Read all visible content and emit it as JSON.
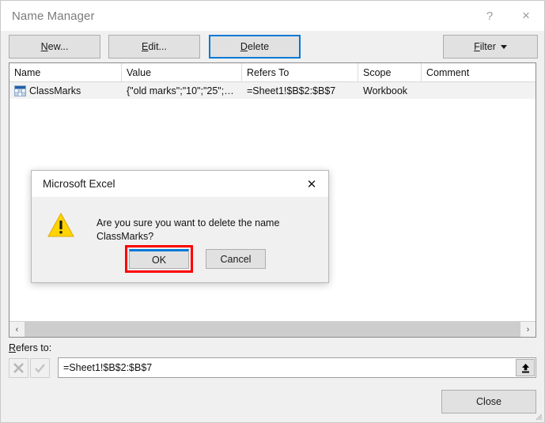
{
  "window": {
    "title": "Name Manager",
    "help_label": "?",
    "close_label": "×"
  },
  "toolbar": {
    "new_label": "New...",
    "new_accel": "N",
    "edit_label": "Edit...",
    "edit_accel": "E",
    "delete_label": "Delete",
    "delete_accel": "D",
    "filter_label": "Filter",
    "filter_accel": "F",
    "focused_button": "delete"
  },
  "list": {
    "columns": [
      {
        "key": "name",
        "label": "Name"
      },
      {
        "key": "value",
        "label": "Value"
      },
      {
        "key": "refers_to",
        "label": "Refers To"
      },
      {
        "key": "scope",
        "label": "Scope"
      },
      {
        "key": "comment",
        "label": "Comment"
      }
    ],
    "rows": [
      {
        "icon": "range-grid-icon",
        "name": "ClassMarks",
        "value": "{\"old marks\";\"10\";\"25\";…",
        "refers_to": "=Sheet1!$B$2:$B$7",
        "scope": "Workbook",
        "comment": "",
        "selected": true
      }
    ]
  },
  "scrollbar": {
    "left_arrow": "‹",
    "right_arrow": "›"
  },
  "refers_to": {
    "label": "Refers to:",
    "label_accel": "R",
    "cancel_icon": "x-icon",
    "confirm_icon": "check-icon",
    "value": "=Sheet1!$B$2:$B$7",
    "placeholder": "",
    "collapse_icon": "collapse-dialog-up-arrow-icon",
    "buttons_enabled": false
  },
  "footer": {
    "close_label": "Close"
  },
  "dialog": {
    "title": "Microsoft Excel",
    "close_label": "✕",
    "icon": "warning-triangle-icon",
    "message": "Are you sure you want to delete the name ClassMarks?",
    "ok_label": "OK",
    "cancel_label": "Cancel",
    "default_button": "ok"
  },
  "annotation": {
    "target": "ok-button",
    "color": "#ff0000"
  },
  "colors": {
    "focus_blue": "#0078d7",
    "annotation_red": "#ff0000",
    "warning_yellow": "#ffd400",
    "button_face": "#e1e1e1",
    "window_bg": "#f0f0f0",
    "row_selected": "#f2f2f2"
  }
}
